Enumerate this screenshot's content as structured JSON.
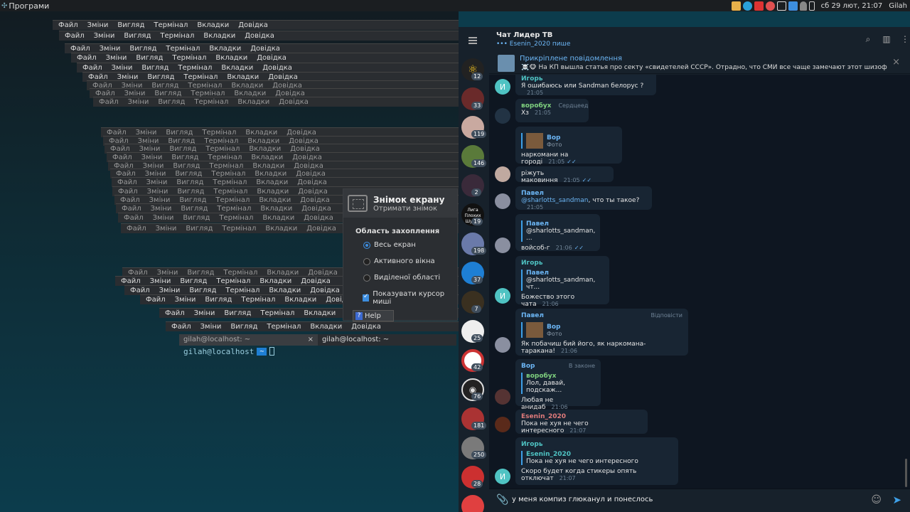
{
  "topbar": {
    "apps_label": "Програми",
    "clock": "сб 29 лют, 21:07",
    "user": "Gilah"
  },
  "terminal": {
    "menu": [
      "Файл",
      "Зміни",
      "Вигляд",
      "Термінал",
      "Вкладки",
      "Довідка"
    ],
    "prompt_user": "gilah@localhost",
    "prompt_chevron": "~",
    "tabs": [
      {
        "label": "gilah@localhost: ~"
      },
      {
        "label": "gilah@localhost: ~"
      }
    ],
    "tab_close": "×"
  },
  "screenshot_dialog": {
    "title": "Знімок екрану",
    "subtitle": "Отримати знімок",
    "area_label": "Область захоплення",
    "options": [
      "Весь екран",
      "Активного вікна",
      "Виділеної області"
    ],
    "cursor_label": "Показувати курсор миші",
    "help_label": "Help"
  },
  "telegram": {
    "chat_title": "Чат Лидер ТВ",
    "typing": "••• Esenin_2020 пише",
    "pinned": {
      "title": "Прикріплене повідомлення",
      "text": "☠️🐵 На КП вышла статья про секту «свидетелей СССР». Отрадно, что СМИ все чаще замечают этот шизофреническ..."
    },
    "sidebar_badges": [
      "12",
      "33",
      "119",
      "146",
      "2",
      "19",
      "198",
      "37",
      "7",
      "25",
      "42",
      "76",
      "181",
      "250",
      "28"
    ],
    "sidebar_logo_text": "Лига Плохих Шуток",
    "messages": {
      "m1": {
        "name": "Игорь",
        "text": "Я ошибаюсь или Sandman белорус ?",
        "time": "21:05",
        "avatar": "И"
      },
      "m2": {
        "name": "воробух",
        "tag": "Сердцеед",
        "text": "Хз",
        "time": "21:05"
      },
      "m3": {
        "reply_name": "Вор",
        "reply_text": "Фото",
        "text": "наркомани на городі",
        "time": "21:05"
      },
      "m4": {
        "text": "ріжуть маковиння",
        "time": "21:05"
      },
      "m5": {
        "name": "Павел",
        "mention": "@sharlotts_sandman",
        "text": ", что ты такое?",
        "time": "21:05"
      },
      "m6": {
        "reply_name": "Павел",
        "reply_text": "@sharlotts_sandman, ...",
        "text": "войсоб-г",
        "time": "21:06"
      },
      "m7": {
        "name": "Игорь",
        "reply_name": "Павел",
        "reply_text": "@sharlotts_sandman, чт...",
        "text": "Божество этого чата",
        "time": "21:06",
        "avatar": "И"
      },
      "m8": {
        "name": "Павел",
        "tag": "Відповісти",
        "reply_name": "Вор",
        "reply_text": "Фото",
        "text": "Як побачиш бий його, як наркомана-таракана!",
        "time": "21:06"
      },
      "m9": {
        "name": "Вор",
        "tag": "В законе",
        "reply_name": "воробух",
        "reply_text": "Лол, давай, подскаж...",
        "text": "Любая не анидаб",
        "time": "21:06"
      },
      "m10": {
        "name": "Esenin_2020",
        "text": "Пока не хуя не чего интересного",
        "time": "21:07"
      },
      "m11": {
        "name": "Игорь",
        "reply_name": "Esenin_2020",
        "reply_text": "Пока не хуя не чего интересного",
        "text": "Скоро будет когда стикеры опять отключат",
        "time": "21:07",
        "avatar": "И"
      }
    },
    "input_text": "у меня компиз глюканул и понеслось"
  },
  "colors": {
    "accent": "#3ea0e8",
    "name_green": "#7fd17f",
    "name_blue": "#6cb6f5",
    "name_red": "#e07b7b",
    "name_teal": "#4fc3c3"
  }
}
